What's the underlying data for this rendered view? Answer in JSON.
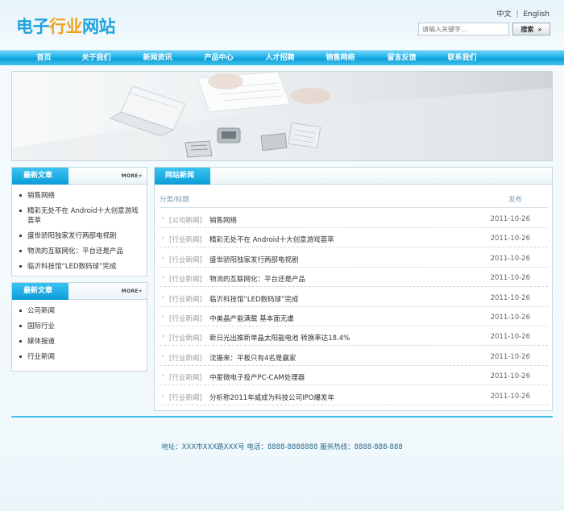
{
  "header": {
    "logo_part1": "电子",
    "logo_part2": "行业",
    "logo_part3": "网站",
    "lang_cn": "中文",
    "lang_sep": "|",
    "lang_en": "English",
    "search_placeholder": "请输入关键字...",
    "search_button": "搜索"
  },
  "nav": [
    {
      "label": "首页"
    },
    {
      "label": "关于我们"
    },
    {
      "label": "新闻资讯"
    },
    {
      "label": "产品中心"
    },
    {
      "label": "人才招聘"
    },
    {
      "label": "销售网络"
    },
    {
      "label": "留言反馈"
    },
    {
      "label": "联系我们"
    }
  ],
  "side_box_1": {
    "title": "最新文章",
    "more": "MORE+",
    "items": [
      {
        "label": "销售网络"
      },
      {
        "label": "精彩无处不在 Android十大创意游戏荟萃"
      },
      {
        "label": "盛世骄阳独家发行两部电视剧"
      },
      {
        "label": "物流的互联网化：平台还是产品"
      },
      {
        "label": "临沂科技馆“LED数码球”完成"
      }
    ]
  },
  "side_box_2": {
    "title": "最新文章",
    "more": "MORE+",
    "items": [
      {
        "label": "公司新闻"
      },
      {
        "label": "国际行业"
      },
      {
        "label": "媒体报道"
      },
      {
        "label": "行业新闻"
      }
    ]
  },
  "main": {
    "title": "网站新闻",
    "col_category_title": "分类/标题",
    "col_publish": "发布",
    "rows": [
      {
        "category": "[公司新闻]",
        "title": "销售网络",
        "date": "2011-10-26"
      },
      {
        "category": "[行业新闻]",
        "title": "精彩无处不在 Android十大创意游戏荟萃",
        "date": "2011-10-26"
      },
      {
        "category": "[行业新闻]",
        "title": "盛世骄阳独家发行两部电视剧",
        "date": "2011-10-26"
      },
      {
        "category": "[行业新闻]",
        "title": "物流的互联网化：平台还是产品",
        "date": "2011-10-26"
      },
      {
        "category": "[行业新闻]",
        "title": "临沂科技馆“LED数码球”完成",
        "date": "2011-10-26"
      },
      {
        "category": "[行业新闻]",
        "title": "中美晶产能满载 基本面无虞",
        "date": "2011-10-26"
      },
      {
        "category": "[行业新闻]",
        "title": "新日光出推新单晶太阳能电池 转换率达18.4%",
        "date": "2011-10-26"
      },
      {
        "category": "[行业新闻]",
        "title": "沈振来：平板只有4名是赢家",
        "date": "2011-10-26"
      },
      {
        "category": "[行业新闻]",
        "title": "中星微电子投产PC-CAM处理器",
        "date": "2011-10-26"
      },
      {
        "category": "[行业新闻]",
        "title": "分析称2011年威成为科技公司IPO爆发年",
        "date": "2011-10-26"
      }
    ]
  },
  "footer": {
    "text": "地址：XXX市XXX路XXX号 电话：8888-8888888 服务热线：8888-888-888"
  }
}
